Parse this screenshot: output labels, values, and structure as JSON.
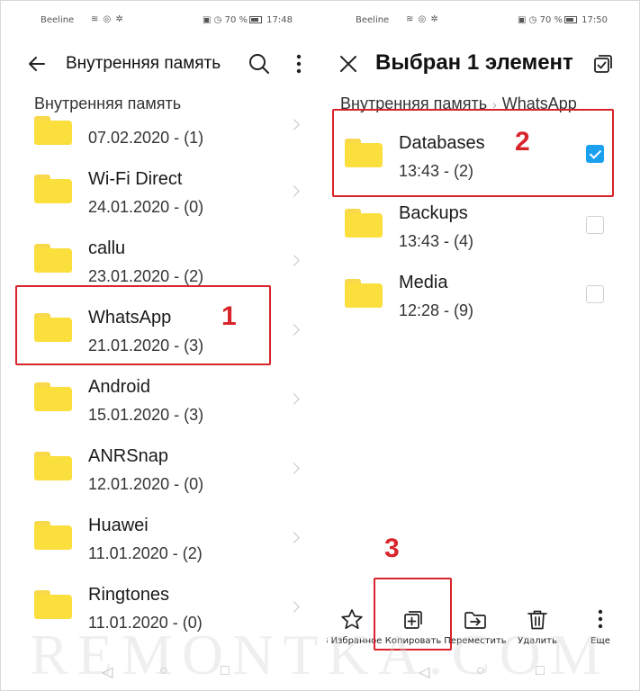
{
  "status_left": {
    "carrier": "Beeline",
    "battery": "70 %",
    "time": "17:48"
  },
  "status_right": {
    "carrier": "Beeline",
    "battery": "70 %",
    "time": "17:50"
  },
  "left": {
    "title": "Внутренняя память",
    "breadcrumb": "Внутренняя память",
    "folders": [
      {
        "name": "",
        "meta": "07.02.2020 - (1)"
      },
      {
        "name": "Wi-Fi Direct",
        "meta": "24.01.2020 - (0)"
      },
      {
        "name": "callu",
        "meta": "23.01.2020 - (2)"
      },
      {
        "name": "WhatsApp",
        "meta": "21.01.2020 - (3)"
      },
      {
        "name": "Android",
        "meta": "15.01.2020 - (3)"
      },
      {
        "name": "ANRSnap",
        "meta": "12.01.2020 - (0)"
      },
      {
        "name": "Huawei",
        "meta": "11.01.2020 - (2)"
      },
      {
        "name": "Ringtones",
        "meta": "11.01.2020 - (0)"
      }
    ]
  },
  "right": {
    "title": "Выбран 1 элемент",
    "breadcrumb": [
      "Внутренняя память",
      "WhatsApp"
    ],
    "folders": [
      {
        "name": "Databases",
        "meta": "13:43 - (2)",
        "checked": true
      },
      {
        "name": "Backups",
        "meta": "13:43 - (4)",
        "checked": false
      },
      {
        "name": "Media",
        "meta": "12:28 - (9)",
        "checked": false
      }
    ],
    "actions": {
      "favorite": "В Избранное",
      "copy": "Копировать",
      "move": "Переместить",
      "delete": "Удалить",
      "more": "Еще"
    }
  },
  "annotations": {
    "step1": "1",
    "step2": "2",
    "step3": "3"
  },
  "watermark": "REMONTKA.COM",
  "colors": {
    "folder": "#fbdf3c",
    "checkbox": "#1aa0ef",
    "annotation": "#d8242a"
  }
}
